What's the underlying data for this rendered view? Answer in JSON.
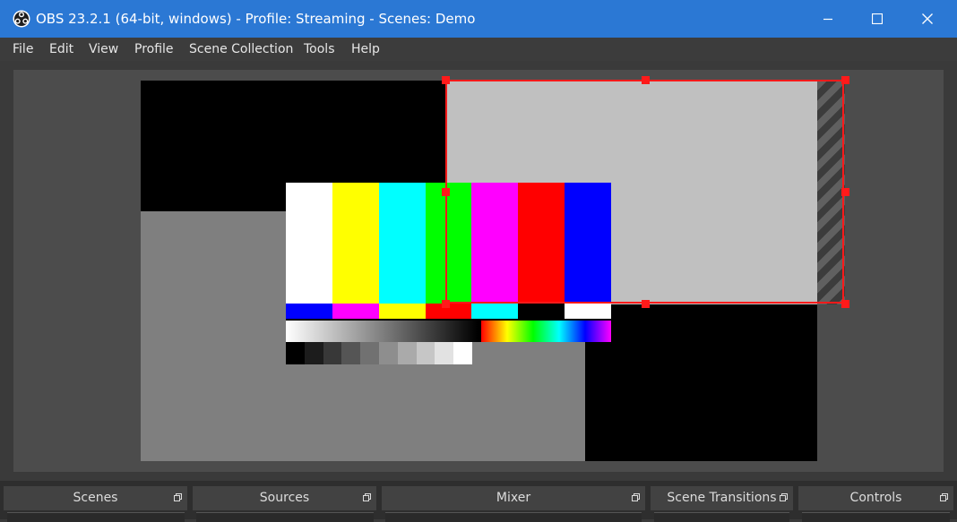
{
  "window": {
    "title": "OBS 23.2.1 (64-bit, windows) - Profile: Streaming - Scenes: Demo",
    "controls": {
      "minimize_icon": "minimize-icon",
      "maximize_icon": "maximize-icon",
      "close_icon": "close-icon"
    }
  },
  "menu": [
    "File",
    "Edit",
    "View",
    "Profile",
    "Scene Collection",
    "Tools",
    "Help"
  ],
  "docks": [
    "Scenes",
    "Sources",
    "Mixer",
    "Scene Transitions",
    "Controls"
  ],
  "colors": {
    "titlebar": "#2b78d4",
    "selection": "#ff1a1a",
    "canvas_gray": "#7f7f7f",
    "light_gray": "#c0c0c0"
  },
  "test_pattern": {
    "top_bars": [
      "#ffffff",
      "#ffff00",
      "#00ffff",
      "#00ff00",
      "#ff00ff",
      "#ff0000",
      "#0000ff"
    ],
    "middle_bars": [
      "#0000ff",
      "#ff00ff",
      "#ffff00",
      "#ff0000",
      "#00ffff",
      "#000000",
      "#ffffff"
    ],
    "gray_steps": [
      "#000000",
      "#1c1c1c",
      "#383838",
      "#555555",
      "#717171",
      "#8e8e8e",
      "#aaaaaa",
      "#c6c6c6",
      "#e2e2e2",
      "#ffffff"
    ]
  }
}
